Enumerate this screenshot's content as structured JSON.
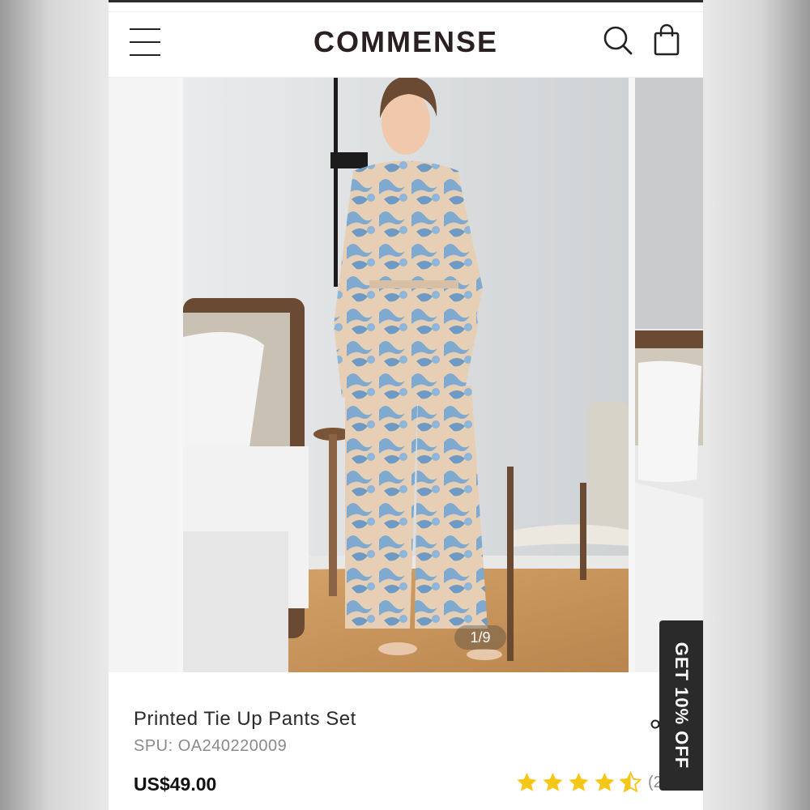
{
  "header": {
    "brand": "COMMENSE",
    "menu_icon": "hamburger-menu-icon",
    "search_icon": "search-icon",
    "cart_icon": "shopping-bag-icon"
  },
  "gallery": {
    "counter": "1/9",
    "current_index": 1,
    "total_images": 9
  },
  "promo": {
    "label": "GET 10% OFF"
  },
  "product": {
    "title": "Printed Tie Up Pants Set",
    "spu": "SPU: OA240220009",
    "price": "US$49.00",
    "rating": 4.5,
    "rating_count": "(2)",
    "share_icon": "share-icon",
    "star_color": "#f5c518"
  }
}
